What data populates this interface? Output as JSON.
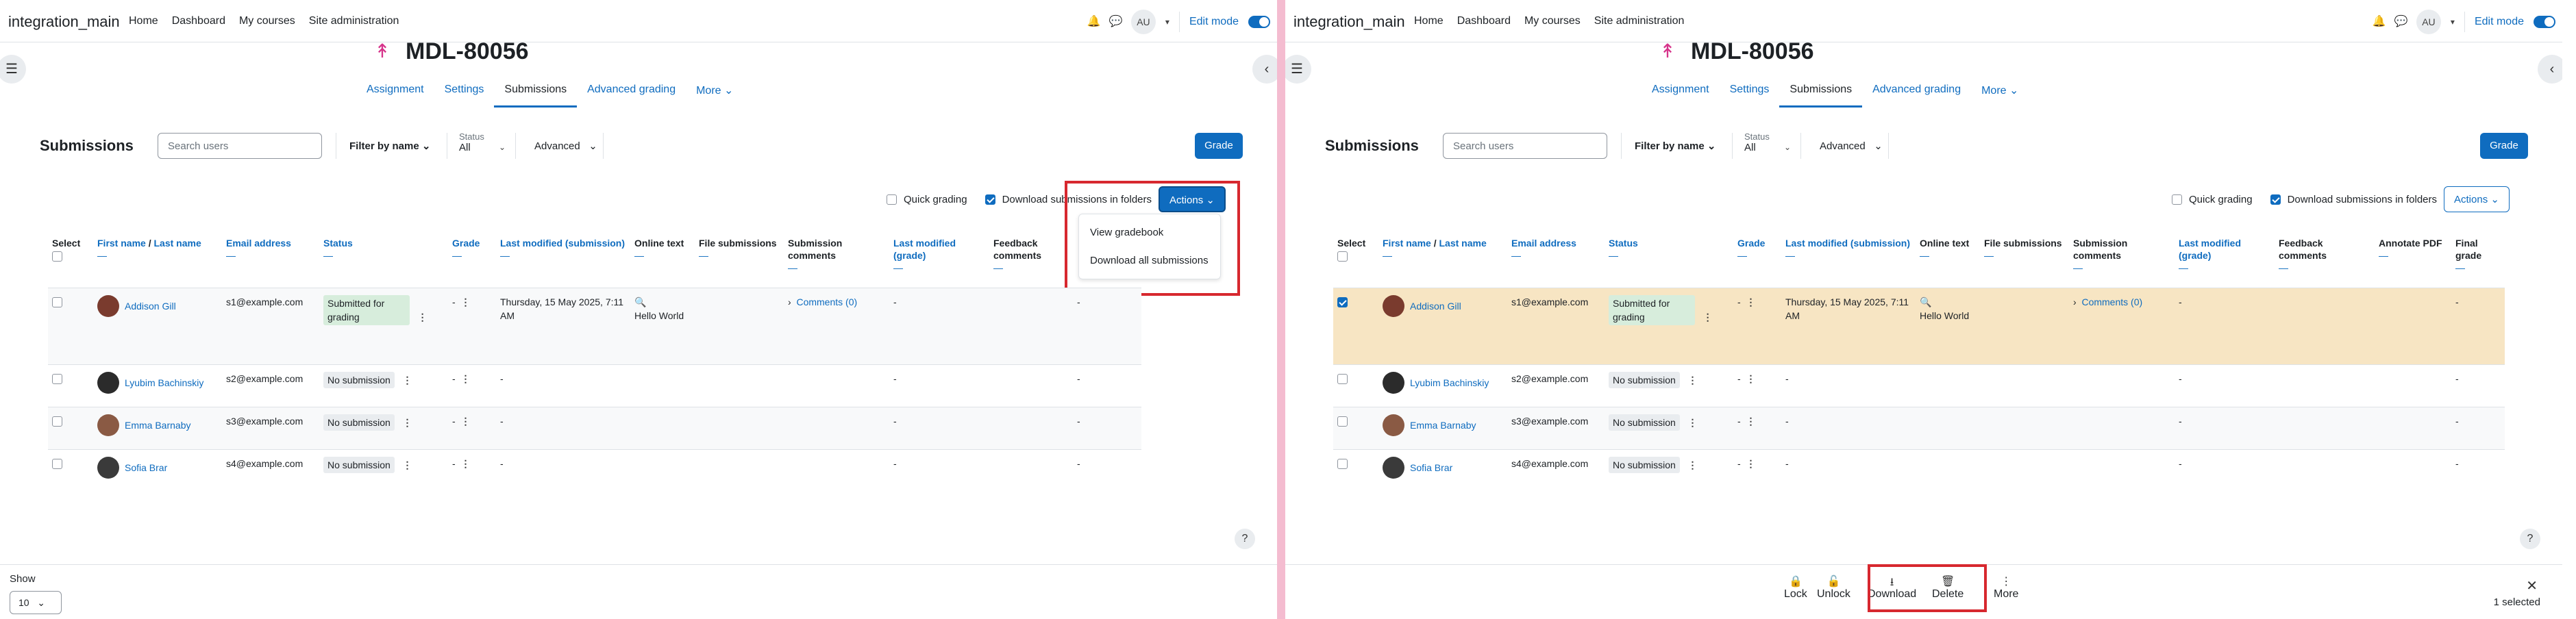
{
  "nav": {
    "brand": "integration_main",
    "links": [
      "Home",
      "Dashboard",
      "My courses",
      "Site administration"
    ],
    "avatar": "AU",
    "edit_mode": "Edit mode"
  },
  "page": {
    "title": "MDL-80056",
    "tabs": [
      "Assignment",
      "Settings",
      "Submissions",
      "Advanced grading",
      "More"
    ],
    "active_tab": "Submissions"
  },
  "toolbar": {
    "heading": "Submissions",
    "search_placeholder": "Search users",
    "filter_by_name": "Filter by name",
    "status_label": "Status",
    "status_value": "All",
    "advanced": "Advanced",
    "grade_button": "Grade"
  },
  "options": {
    "quick_grading": "Quick grading",
    "download_folders": "Download submissions in folders",
    "actions": "Actions"
  },
  "actions_menu": [
    "View gradebook",
    "Download all submissions"
  ],
  "table": {
    "headers": {
      "select": "Select",
      "first_name": "First name",
      "slash": " / ",
      "last_name": "Last name",
      "email": "Email address",
      "status": "Status",
      "grade": "Grade",
      "last_modified_submission": "Last modified (submission)",
      "online_text": "Online text",
      "file_submissions": "File submissions",
      "submission_comments": "Submission comments",
      "last_modified_grade": "Last modified (grade)",
      "feedback_comments": "Feedback comments",
      "annotate_pdf": "Annotate PDF",
      "final_grade": "Final grade"
    },
    "rows": [
      {
        "name": "Addison Gill",
        "email": "s1@example.com",
        "status": "Submitted for grading",
        "grade": "-",
        "modified": "Thursday, 15 May 2025, 7:11 AM",
        "online_text": "Hello World",
        "comments": "Comments (0)",
        "grade_modified": "-",
        "final": "-"
      },
      {
        "name": "Lyubim Bachinskiy",
        "email": "s2@example.com",
        "status": "No submission",
        "grade": "-",
        "modified": "-",
        "grade_modified": "-",
        "final": "-"
      },
      {
        "name": "Emma Barnaby",
        "email": "s3@example.com",
        "status": "No submission",
        "grade": "-",
        "modified": "-",
        "grade_modified": "-",
        "final": "-"
      },
      {
        "name": "Sofia Brar",
        "email": "s4@example.com",
        "status": "No submission",
        "grade": "-",
        "modified": "-",
        "grade_modified": "-",
        "final": "-"
      }
    ]
  },
  "footer": {
    "show": "Show",
    "per_page": "10"
  },
  "bulk": {
    "lock": "Lock",
    "unlock": "Unlock",
    "download": "Download",
    "delete": "Delete",
    "more": "More",
    "selected": "1 selected"
  },
  "colors": {
    "accent": "#0f6cbf",
    "highlight": "#d7282f",
    "divider": "#f4bcd0",
    "selected_row": "#f7e5c3"
  }
}
